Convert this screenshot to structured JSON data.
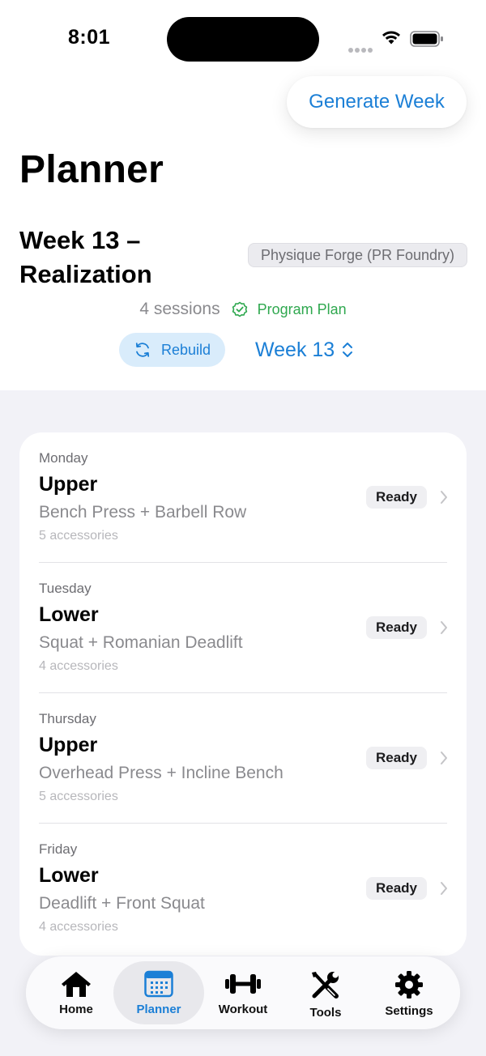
{
  "status_bar": {
    "time": "8:01"
  },
  "header": {
    "generate_button": "Generate Week",
    "title": "Planner",
    "week_title": "Week 13 – Realization",
    "program_badge": "Physique Forge (PR Foundry)",
    "sessions_count": "4 sessions",
    "plan_label": "Program Plan",
    "rebuild_button": "Rebuild",
    "week_selector": "Week 13"
  },
  "sessions": [
    {
      "day": "Monday",
      "title": "Upper",
      "lifts": "Bench Press + Barbell Row",
      "accessories": "5 accessories",
      "status": "Ready"
    },
    {
      "day": "Tuesday",
      "title": "Lower",
      "lifts": "Squat + Romanian Deadlift",
      "accessories": "4 accessories",
      "status": "Ready"
    },
    {
      "day": "Thursday",
      "title": "Upper",
      "lifts": "Overhead Press + Incline Bench",
      "accessories": "5 accessories",
      "status": "Ready"
    },
    {
      "day": "Friday",
      "title": "Lower",
      "lifts": "Deadlift + Front Squat",
      "accessories": "4 accessories",
      "status": "Ready"
    }
  ],
  "tab_bar": {
    "items": [
      {
        "label": "Home",
        "icon": "house-icon",
        "active": false
      },
      {
        "label": "Planner",
        "icon": "calendar-icon",
        "active": true
      },
      {
        "label": "Workout",
        "icon": "dumbbell-icon",
        "active": false
      },
      {
        "label": "Tools",
        "icon": "tools-icon",
        "active": false
      },
      {
        "label": "Settings",
        "icon": "gear-icon",
        "active": false
      }
    ]
  },
  "colors": {
    "accent": "#1b7fd6",
    "success": "#2fa84f",
    "background": "#f2f2f7"
  }
}
